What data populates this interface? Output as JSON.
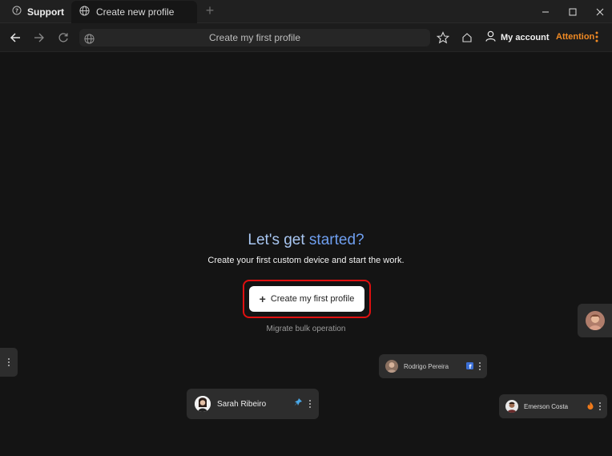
{
  "tabs": {
    "support_label": "Support",
    "active_label": "Create new profile",
    "new_tab_symbol": "+"
  },
  "toolbar": {
    "address_text": "Create my first profile",
    "account_label": "My account",
    "attention_label": "Attention"
  },
  "hero": {
    "title_prefix": "Let's get",
    "title_accent": "started?",
    "subtitle": "Create your first custom device and start the work.",
    "create_button_label": "Create my first profile",
    "create_button_icon": "+",
    "migrate_label": "Migrate bulk operation"
  },
  "profiles": [
    {
      "name": "Rodrigo Pereira",
      "badge_icon": "facebook-icon"
    },
    {
      "name": "Sarah Ribeiro",
      "badge_icon": "pin-icon"
    },
    {
      "name": "Emerson Costa",
      "badge_icon": "flame-icon"
    }
  ],
  "colors": {
    "accent_blue": "#6f9ff0",
    "attention_orange": "#f08a24",
    "highlight_red": "#e01010",
    "background": "#141414"
  }
}
